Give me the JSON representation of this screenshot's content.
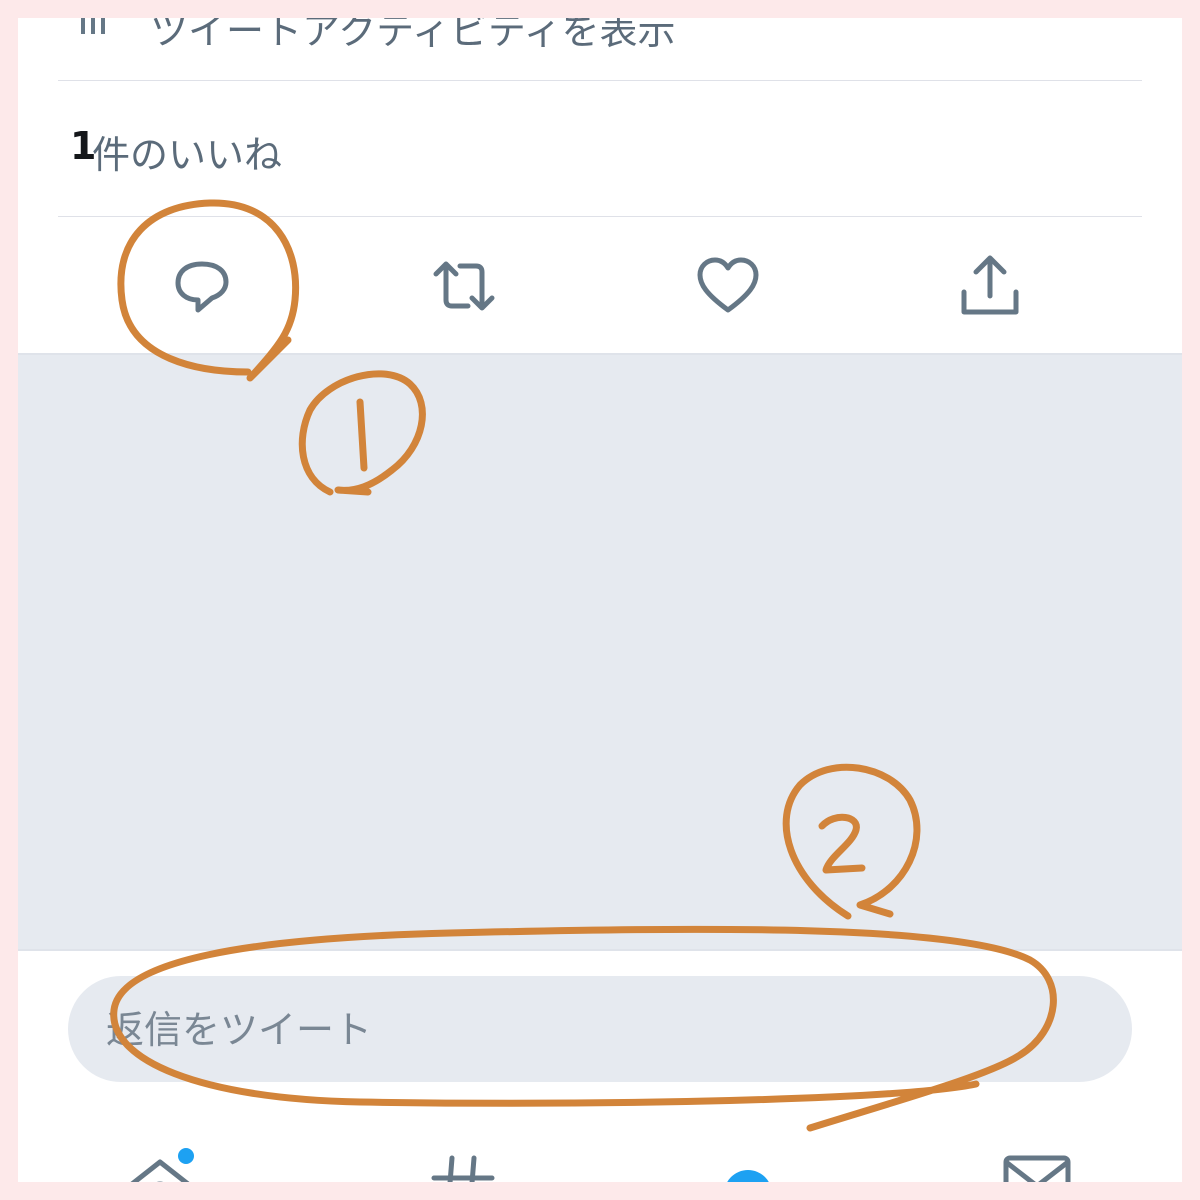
{
  "tweet": {
    "analytics_label": "ツイートアクティビティを表示",
    "likes_count": "1",
    "likes_suffix": "件のいいね"
  },
  "actions": [
    {
      "icon": "reply-icon"
    },
    {
      "icon": "retweet-icon"
    },
    {
      "icon": "like-icon"
    },
    {
      "icon": "share-icon"
    }
  ],
  "reply": {
    "placeholder": "返信をツイート"
  },
  "tabbar": [
    {
      "icon": "home-icon",
      "has_notification_dot": true
    },
    {
      "icon": "explore-icon"
    },
    {
      "icon": "profile-icon"
    },
    {
      "icon": "messages-icon"
    }
  ],
  "annotations": {
    "marks": [
      "1",
      "2"
    ],
    "color": "#d2843a"
  },
  "colors": {
    "icon_gray": "#657786",
    "accent_blue": "#1da1f2",
    "divider": "#dfe1e8",
    "gray_area": "#e6eaf0",
    "frame": "#fde9ea"
  }
}
